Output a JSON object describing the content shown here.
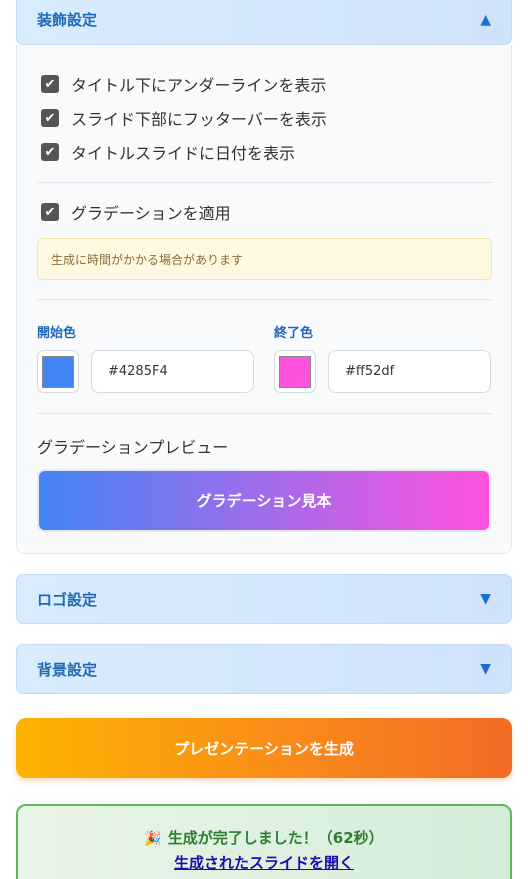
{
  "sections": {
    "decoration": {
      "title": "装飾設定",
      "arrow": "▲"
    },
    "logo": {
      "title": "ロゴ設定",
      "arrow": "▼"
    },
    "background": {
      "title": "背景設定",
      "arrow": "▼"
    }
  },
  "decoration": {
    "checkboxes": [
      {
        "label": "タイトル下にアンダーラインを表示",
        "checked": true
      },
      {
        "label": "スライド下部にフッターバーを表示",
        "checked": true
      },
      {
        "label": "タイトルスライドに日付を表示",
        "checked": true
      }
    ],
    "gradient_checkbox": {
      "label": "グラデーションを適用",
      "checked": true
    },
    "notice": "生成に時間がかかる場合があります",
    "start_color": {
      "label": "開始色",
      "value": "#4285F4"
    },
    "end_color": {
      "label": "終了色",
      "value": "#ff52df"
    },
    "preview_label": "グラデーションプレビュー",
    "preview_text": "グラデーション見本"
  },
  "generate_button": "プレゼンテーションを生成",
  "result": {
    "icon": "🎉",
    "message": "生成が完了しました！（62秒）",
    "link": "生成されたスライドを開く"
  },
  "colors": {
    "accent": "#1f69b9",
    "success": "#2e7d32",
    "gradient_start": "#4285F4",
    "gradient_end": "#ff52df"
  }
}
